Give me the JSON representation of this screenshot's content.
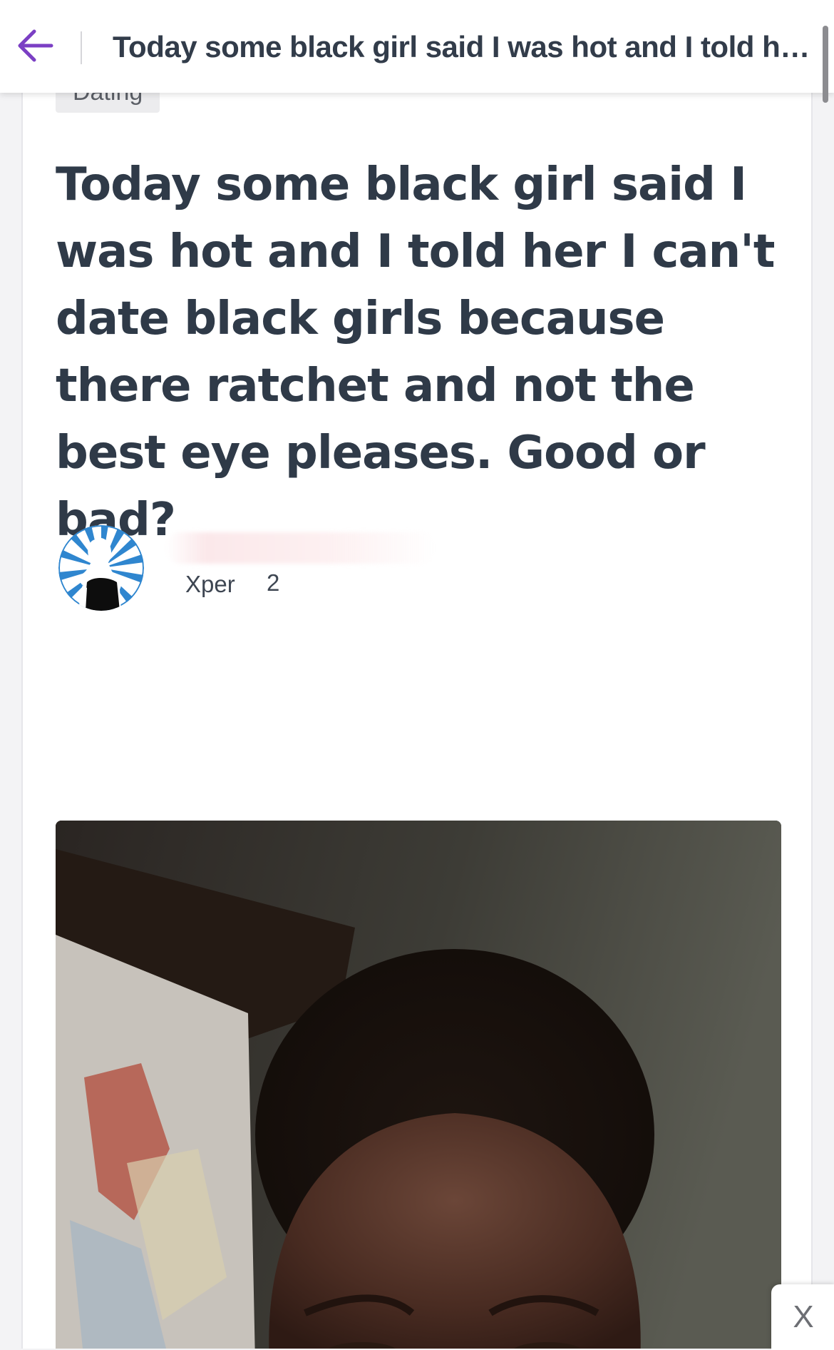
{
  "header": {
    "title": "Today some black girl said I was hot and I told her...",
    "back_icon": "arrow-left-icon"
  },
  "colors": {
    "accent": "#7b3fc4",
    "title_text": "#2f3a48",
    "avatar_blue": "#2f86cf"
  },
  "post": {
    "category": "Dating",
    "title": "Today some black girl said I was hot and I told her I can't date black girls because there ratchet and not the best eye pleases. Good or bad?",
    "author": {
      "avatar_icon": "silhouette-avatar-icon",
      "xper_label": "Xper",
      "xper_level": "2"
    },
    "photo_icon": "selfie-photo"
  },
  "ad": {
    "close_label": "X"
  }
}
